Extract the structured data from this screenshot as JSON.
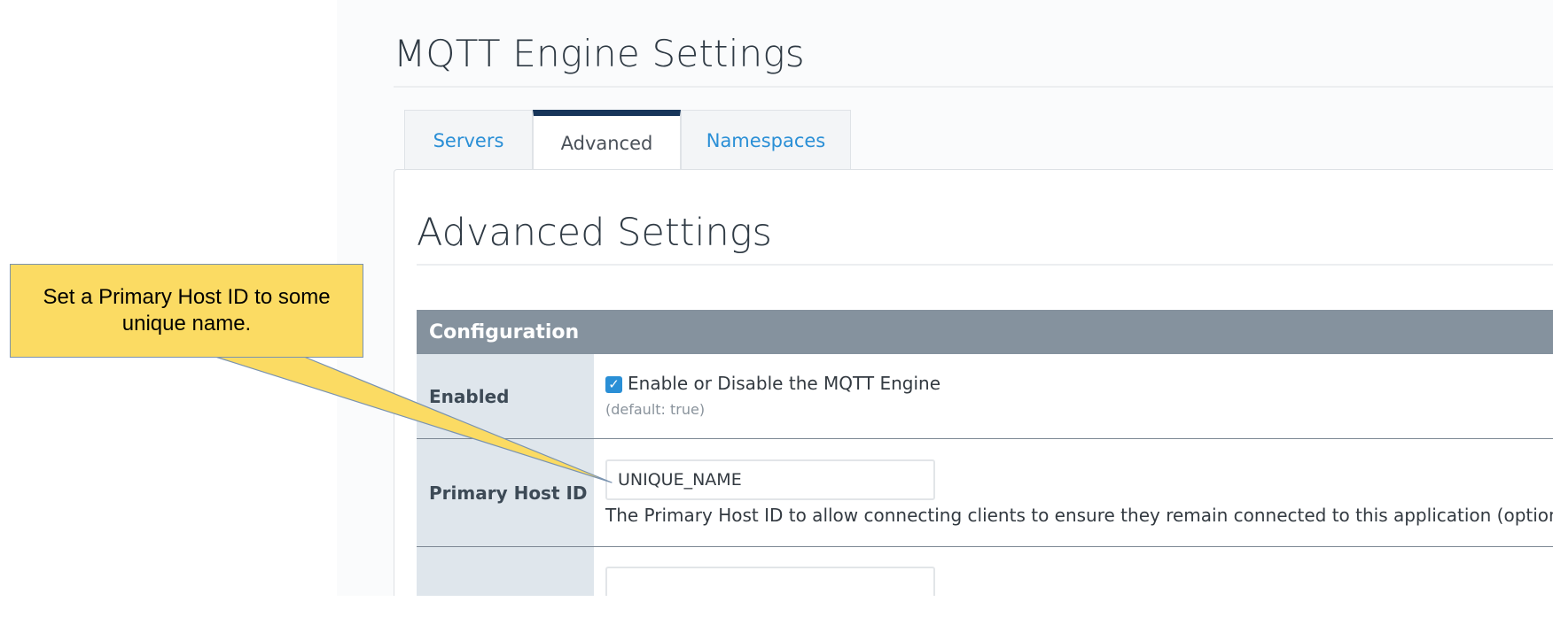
{
  "page": {
    "title": "MQTT Engine Settings"
  },
  "tabs": [
    {
      "label": "Servers",
      "active": false
    },
    {
      "label": "Advanced",
      "active": true
    },
    {
      "label": "Namespaces",
      "active": false
    }
  ],
  "section": {
    "title": "Advanced Settings"
  },
  "config": {
    "header": "Configuration",
    "rows": [
      {
        "label": "Enabled",
        "checkbox_checked": true,
        "checkbox_label": "Enable or Disable the MQTT Engine",
        "hint": "(default: true)"
      },
      {
        "label": "Primary Host ID",
        "value": "UNIQUE_NAME",
        "description": "The Primary Host ID to allow connecting clients to ensure they remain connected to this application (optional)"
      },
      {
        "label": "",
        "value": ""
      }
    ]
  },
  "callout": {
    "text": "Set a Primary Host ID to some unique name."
  },
  "colors": {
    "tab_link": "#2a8fd6",
    "active_tab_bar": "#17355a",
    "config_header_bg": "#85929e",
    "label_column_bg": "#dfe6ec",
    "checkbox": "#2a8fd6",
    "callout_bg": "#fbdb63"
  },
  "icons": {
    "checkbox": "check-icon"
  }
}
